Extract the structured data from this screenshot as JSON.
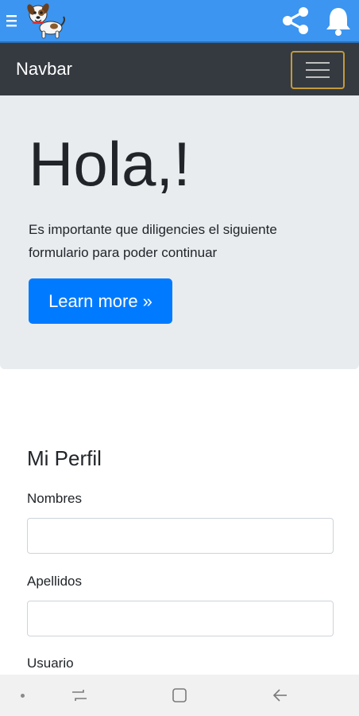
{
  "app_bar": {
    "menu_icon": "hamburger-menu-icon",
    "logo_icon": "cartoon-dog-logo-icon",
    "share_icon": "share-icon",
    "notifications_icon": "bell-icon",
    "color": "#3c95f0"
  },
  "navbar": {
    "brand": "Navbar",
    "toggler_icon": "hamburger-menu-icon",
    "background": "#343a40"
  },
  "jumbotron": {
    "title": "Hola,!",
    "lead": "Es importante que diligencies el siguiente formulario para poder continuar",
    "button_label": "Learn more »",
    "button_color": "#007bff"
  },
  "form": {
    "title": "Mi Perfil",
    "fields": [
      {
        "label": "Nombres",
        "value": "",
        "placeholder": ""
      },
      {
        "label": "Apellidos",
        "value": "",
        "placeholder": ""
      },
      {
        "label": "Usuario",
        "value": "",
        "placeholder": ""
      }
    ]
  },
  "system_nav": {
    "dot_icon": "dot-icon",
    "recents_icon": "recent-apps-icon",
    "home_icon": "home-square-icon",
    "back_icon": "back-arrow-icon"
  }
}
